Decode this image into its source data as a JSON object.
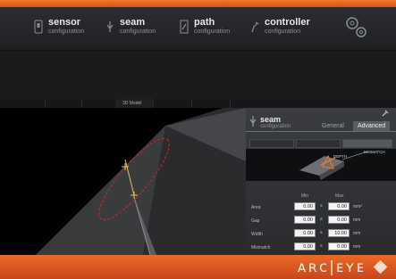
{
  "nav": {
    "items": [
      {
        "title": "sensor",
        "subtitle": "configuration",
        "icon": "sensor-icon"
      },
      {
        "title": "seam",
        "subtitle": "configuration",
        "icon": "seam-icon"
      },
      {
        "title": "path",
        "subtitle": "configuration",
        "icon": "path-icon"
      },
      {
        "title": "controller",
        "subtitle": "configuration",
        "icon": "controller-icon"
      }
    ],
    "settings_icon": "gears-icon"
  },
  "view_tabs": [
    "",
    "",
    "",
    "3D Model",
    "",
    ""
  ],
  "panel": {
    "title": "seam",
    "subtitle": "configuration",
    "tabs": [
      "General",
      "Advanced"
    ],
    "active_tab": "Advanced",
    "sub_tabs": [
      "",
      "",
      ""
    ],
    "diagram_labels": {
      "depth": "DEPTH",
      "mismatch": "MISMATCH"
    },
    "col_headers": {
      "min": "Min",
      "max": "Max"
    },
    "rows": [
      {
        "label": "Area",
        "min": "0.00",
        "max": "0.00",
        "unit": "mm²"
      },
      {
        "label": "Gap",
        "min": "0.00",
        "max": "0.00",
        "unit": "mm"
      },
      {
        "label": "Width",
        "min": "0.00",
        "max": "10.00",
        "unit": "mm"
      },
      {
        "label": "Mismatch",
        "min": "0.00",
        "max": "0.00",
        "unit": "mm"
      }
    ]
  },
  "brand": {
    "logo": "ᴀʀᴄ|ᴇʏᴇ",
    "accent": "#e2581f"
  }
}
